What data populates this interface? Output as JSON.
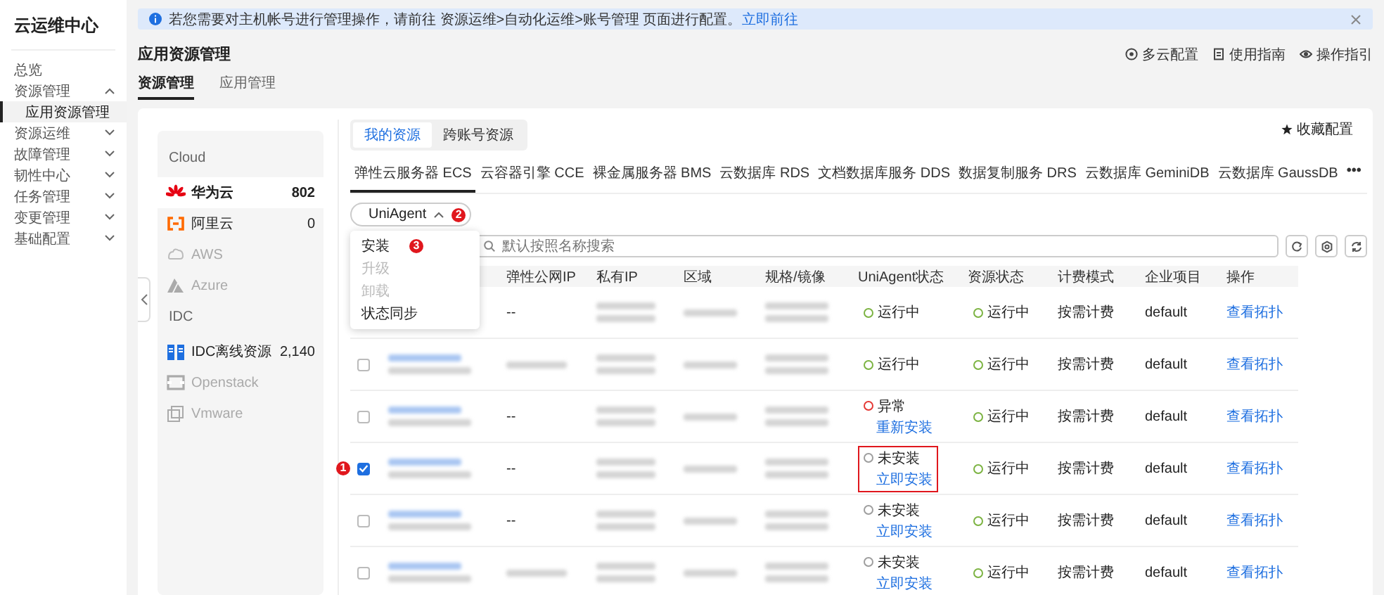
{
  "sidebar": {
    "title": "云运维中心",
    "items": [
      {
        "label": "总览",
        "selected": false
      },
      {
        "label": "资源管理",
        "selected": false,
        "expanded": true,
        "children": [
          {
            "label": "应用资源管理",
            "selected": true
          }
        ]
      },
      {
        "label": "资源运维",
        "selected": false,
        "expanded": false
      },
      {
        "label": "故障管理",
        "selected": false,
        "expanded": false
      },
      {
        "label": "韧性中心",
        "selected": false,
        "expanded": false
      },
      {
        "label": "任务管理",
        "selected": false,
        "expanded": false
      },
      {
        "label": "变更管理",
        "selected": false,
        "expanded": false
      },
      {
        "label": "基础配置",
        "selected": false,
        "expanded": false
      }
    ]
  },
  "notice": {
    "text": "若您需要对主机帐号进行管理操作，请前往 资源运维>自动化运维>账号管理 页面进行配置。",
    "link": "立即前往"
  },
  "page": {
    "title": "应用资源管理",
    "links": [
      "多云配置",
      "使用指南",
      "操作指引"
    ]
  },
  "tabs": [
    {
      "label": "资源管理",
      "selected": true
    },
    {
      "label": "应用管理",
      "selected": false
    }
  ],
  "providers": [
    {
      "title": "Cloud",
      "items": [
        {
          "label": "华为云",
          "count": "802",
          "selected": true,
          "disabled": false
        },
        {
          "label": "阿里云",
          "count": "0",
          "selected": false,
          "disabled": false
        },
        {
          "label": "AWS",
          "selected": false,
          "disabled": true
        },
        {
          "label": "Azure",
          "selected": false,
          "disabled": true
        }
      ]
    },
    {
      "title": "IDC",
      "items": [
        {
          "label": "IDC离线资源",
          "count": "2,140",
          "selected": false,
          "disabled": false
        },
        {
          "label": "Openstack",
          "selected": false,
          "disabled": true
        },
        {
          "label": "Vmware",
          "selected": false,
          "disabled": true
        }
      ]
    }
  ],
  "scope_tabs": [
    {
      "label": "我的资源",
      "selected": true
    },
    {
      "label": "跨账号资源",
      "selected": false
    }
  ],
  "favorite": "收藏配置",
  "service_tabs": [
    {
      "label": "弹性云服务器 ECS",
      "selected": true
    },
    {
      "label": "云容器引擎 CCE",
      "selected": false
    },
    {
      "label": "裸金属服务器 BMS",
      "selected": false
    },
    {
      "label": "云数据库 RDS",
      "selected": false
    },
    {
      "label": "文档数据库服务 DDS",
      "selected": false
    },
    {
      "label": "数据复制服务 DRS",
      "selected": false
    },
    {
      "label": "云数据库 GeminiDB",
      "selected": false
    },
    {
      "label": "云数据库 GaussDB",
      "selected": false
    }
  ],
  "more": "•••",
  "agent_menu": {
    "label": "UniAgent",
    "badge": "2",
    "expanded": true,
    "items": [
      {
        "label": "安装",
        "disabled": false,
        "badge": "3"
      },
      {
        "label": "升级",
        "disabled": true
      },
      {
        "label": "卸载",
        "disabled": true
      },
      {
        "label": "状态同步",
        "disabled": false
      }
    ]
  },
  "search": {
    "placeholder": "默认按照名称搜索"
  },
  "table": {
    "columns": [
      "弹性公网IP",
      "私有IP",
      "区域",
      "规格/镜像",
      "UniAgent状态",
      "资源状态",
      "计费模式",
      "企业项目",
      "操作"
    ],
    "rows": [
      {
        "public_ip": "--",
        "highlighted": false,
        "agent_status": {
          "label": "运行中",
          "color": "#7cb342"
        },
        "resource_status": {
          "label": "运行中",
          "color": "#7cb342"
        },
        "billing": "按需计费",
        "project": "default",
        "action": "查看拓扑"
      },
      {
        "checked": false,
        "highlighted": false,
        "agent_status": {
          "label": "运行中",
          "color": "#7cb342"
        },
        "resource_status": {
          "label": "运行中",
          "color": "#7cb342"
        },
        "billing": "按需计费",
        "project": "default",
        "action": "查看拓扑"
      },
      {
        "checked": false,
        "public_ip": "--",
        "highlighted": false,
        "agent_status": {
          "label": "异常",
          "color": "#e53935",
          "action": "重新安装"
        },
        "resource_status": {
          "label": "运行中",
          "color": "#7cb342"
        },
        "billing": "按需计费",
        "project": "default",
        "action": "查看拓扑"
      },
      {
        "checked": true,
        "badge": "1",
        "public_ip": "--",
        "highlighted": true,
        "agent_status": {
          "label": "未安装",
          "color": "#9e9e9e",
          "action": "立即安装"
        },
        "resource_status": {
          "label": "运行中",
          "color": "#7cb342"
        },
        "billing": "按需计费",
        "project": "default",
        "action": "查看拓扑"
      },
      {
        "checked": false,
        "public_ip": "--",
        "highlighted": false,
        "agent_status": {
          "label": "未安装",
          "color": "#9e9e9e",
          "action": "立即安装"
        },
        "resource_status": {
          "label": "运行中",
          "color": "#7cb342"
        },
        "billing": "按需计费",
        "project": "default",
        "action": "查看拓扑"
      },
      {
        "checked": false,
        "highlighted": false,
        "agent_status": {
          "label": "未安装",
          "color": "#9e9e9e",
          "action": "立即安装"
        },
        "resource_status": {
          "label": "运行中",
          "color": "#7cb342"
        },
        "billing": "按需计费",
        "project": "default",
        "action": "查看拓扑"
      }
    ]
  }
}
